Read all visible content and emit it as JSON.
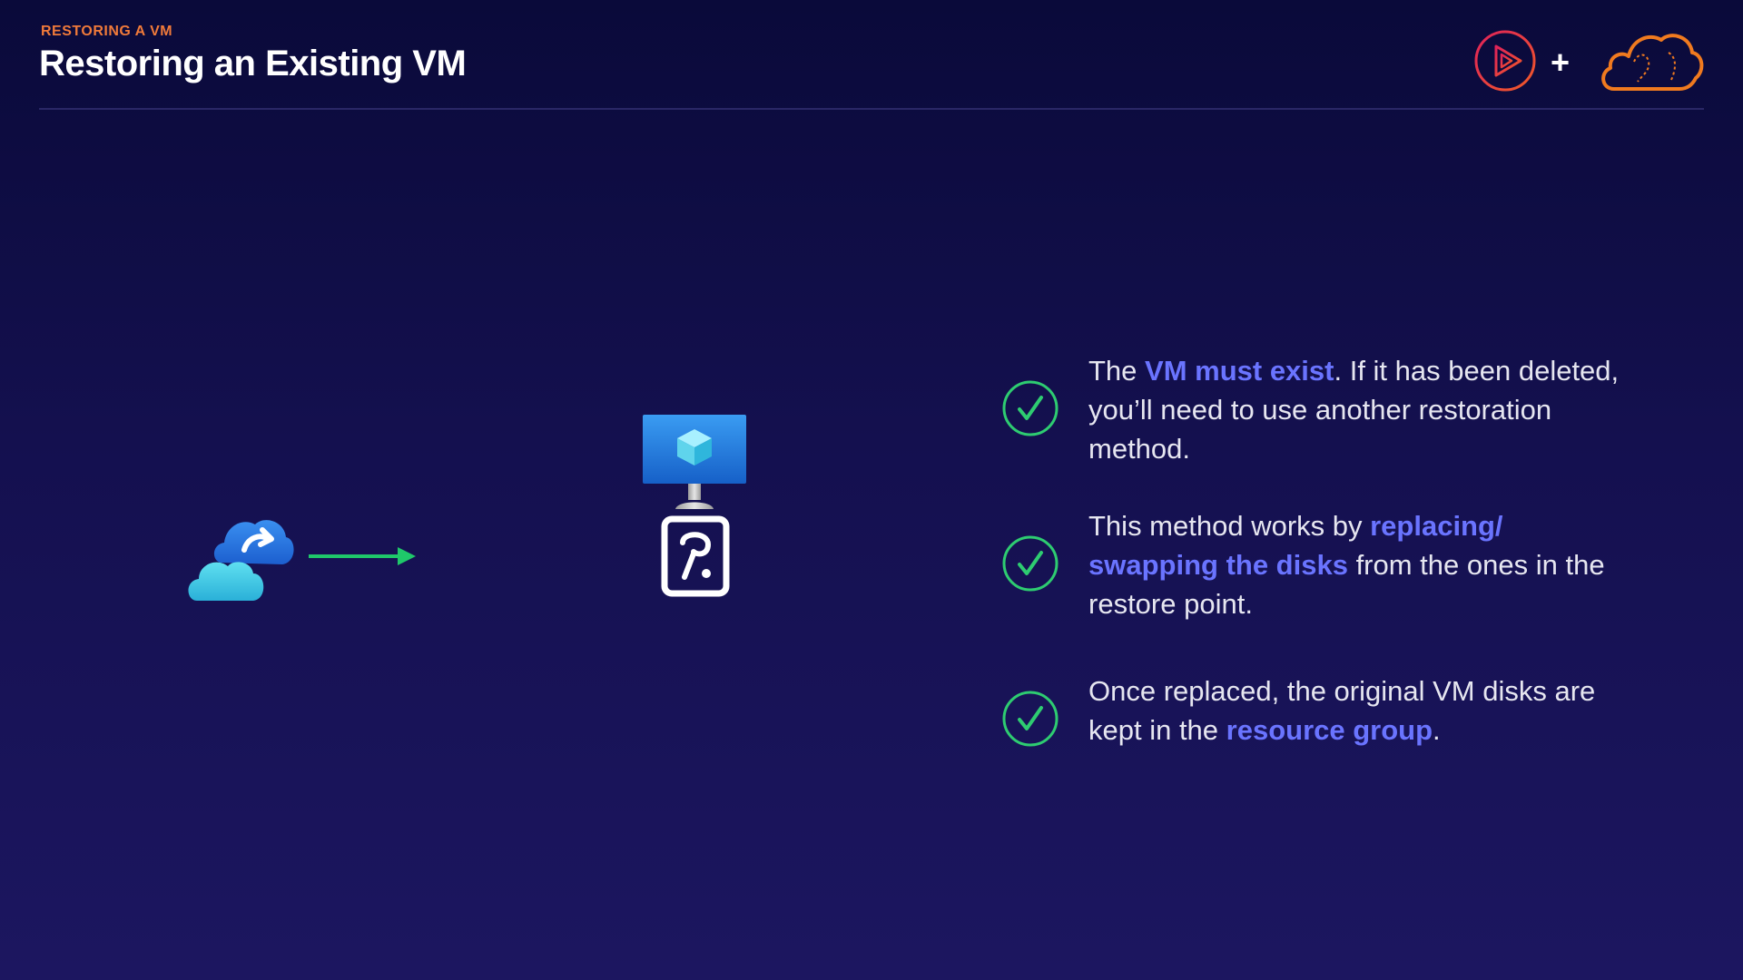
{
  "header": {
    "eyebrow": "RESTORING A VM",
    "title": "Restoring an Existing VM"
  },
  "logos": {
    "plus": "+",
    "play_icon": "play-logo-icon",
    "cloud_icon": "cloud-logo-icon"
  },
  "diagram": {
    "source_icon": "cloud-restore-icon",
    "arrow_icon": "arrow-right-icon",
    "vm_icon": "virtual-machine-icon",
    "disk_icon": "disk-icon"
  },
  "bullets": [
    {
      "parts": [
        "The ",
        "VM must exist",
        ". If it has been deleted, you’ll need to use another restoration method."
      ]
    },
    {
      "parts": [
        "This method works by ",
        "replacing/ swapping the disks",
        " from the ones in the restore point."
      ]
    },
    {
      "parts": [
        "Once replaced, the original VM disks are kept in the ",
        "resource group",
        "."
      ]
    }
  ],
  "colors": {
    "accent_orange": "#f07a3a",
    "highlight_blue": "#6a74ff",
    "check_green": "#2ecc71",
    "background_top": "#0a0a3a",
    "background_bottom": "#1c1660"
  }
}
